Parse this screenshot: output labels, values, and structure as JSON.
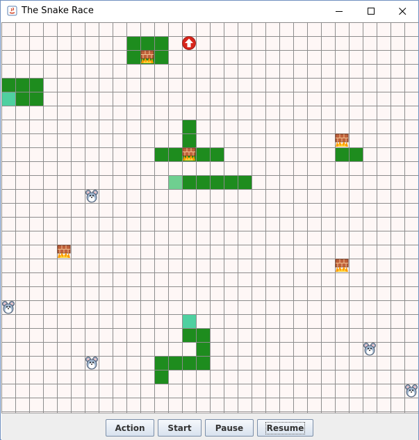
{
  "window": {
    "title": "The Snake Race",
    "controls": [
      "minimize",
      "maximize",
      "close"
    ]
  },
  "game": {
    "grid": {
      "cols": 30,
      "rows": 28
    },
    "colors": {
      "background": "#fef7f6",
      "grid_line": "#8c8c8c",
      "snake_body": "#1e8c1e",
      "snake_head_dark": "#4fd0a0",
      "snake_head_light": "#6fcf90"
    },
    "snakes": [
      {
        "cells": [
          [
            9,
            1
          ],
          [
            10,
            1
          ],
          [
            11,
            1
          ],
          [
            9,
            2
          ],
          [
            10,
            2
          ],
          [
            11,
            2
          ]
        ],
        "head": null
      },
      {
        "cells": [
          [
            0,
            4
          ],
          [
            1,
            4
          ],
          [
            2,
            4
          ],
          [
            0,
            5
          ],
          [
            1,
            5
          ],
          [
            2,
            5
          ]
        ],
        "head": [
          0,
          5
        ],
        "head_color": "#4fd0a0"
      },
      {
        "cells": [
          [
            13,
            7
          ],
          [
            13,
            8
          ],
          [
            11,
            9
          ],
          [
            12,
            9
          ],
          [
            13,
            9
          ],
          [
            14,
            9
          ],
          [
            15,
            9
          ]
        ],
        "head": null
      },
      {
        "cells": [
          [
            24,
            9
          ],
          [
            25,
            9
          ]
        ],
        "head": null
      },
      {
        "cells": [
          [
            12,
            11
          ],
          [
            13,
            11
          ],
          [
            14,
            11
          ],
          [
            15,
            11
          ],
          [
            16,
            11
          ],
          [
            17,
            11
          ]
        ],
        "head": [
          12,
          11
        ],
        "head_color": "#6fcf90"
      },
      {
        "cells": [
          [
            13,
            21
          ],
          [
            13,
            22
          ],
          [
            14,
            22
          ],
          [
            14,
            23
          ],
          [
            11,
            24
          ],
          [
            12,
            24
          ],
          [
            13,
            24
          ],
          [
            14,
            24
          ],
          [
            11,
            25
          ]
        ],
        "head": [
          13,
          21
        ],
        "head_color": "#4fd0a0"
      }
    ],
    "walls": [
      [
        10,
        2
      ],
      [
        13,
        9
      ],
      [
        24,
        8
      ],
      [
        4,
        16
      ],
      [
        24,
        17
      ]
    ],
    "mice": [
      [
        6,
        12
      ],
      [
        0,
        20
      ],
      [
        26,
        23
      ],
      [
        6,
        24
      ],
      [
        29,
        26
      ]
    ],
    "arrows": [
      {
        "cell": [
          13,
          1
        ],
        "direction": "up"
      }
    ]
  },
  "controls": {
    "action_label": "Action",
    "start_label": "Start",
    "pause_label": "Pause",
    "resume_label": "Resume"
  }
}
